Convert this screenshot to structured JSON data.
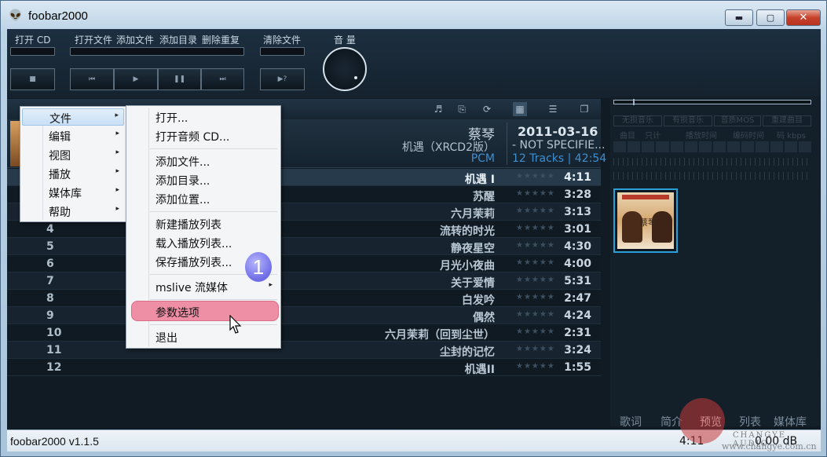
{
  "window": {
    "title": "foobar2000",
    "app_icon": "foobar-alien-icon",
    "min_label": "▬",
    "max_label": "▢",
    "close_label": "✕"
  },
  "toolbar": {
    "open_cd": "打开 CD",
    "open_file": "打开文件",
    "add_file": "添加文件",
    "add_dir": "添加目录",
    "remove_dup": "删除重复",
    "clear_files": "清除文件",
    "volume": "音 量",
    "stop_icon": "■",
    "prev_icon": "⏮",
    "play_icon": "▶",
    "pause_icon": "❚❚",
    "next_icon": "⏭",
    "random_icon": "▶?"
  },
  "info": {
    "artist": "蔡琴",
    "album": "机遇（XRCD2版）",
    "format": "PCM",
    "date": "2011-03-16",
    "genre": "- NOT SPECIFIE...",
    "tracks": "12 Tracks | 42:54"
  },
  "tracks": [
    {
      "num": "",
      "title": "机遇 I",
      "rating": "★★★★★",
      "length": "4:11"
    },
    {
      "num": "",
      "title": "苏醒",
      "rating": "★★★★★",
      "length": "3:28"
    },
    {
      "num": "",
      "title": "六月茉莉",
      "rating": "★★★★★",
      "length": "3:13"
    },
    {
      "num": "4",
      "title": "流转的时光",
      "rating": "★★★★★",
      "length": "3:01"
    },
    {
      "num": "5",
      "title": "静夜星空",
      "rating": "★★★★★",
      "length": "4:30"
    },
    {
      "num": "6",
      "title": "月光小夜曲",
      "rating": "★★★★★",
      "length": "4:00"
    },
    {
      "num": "7",
      "title": "关于爱情",
      "rating": "★★★★★",
      "length": "5:31"
    },
    {
      "num": "8",
      "title": "白发吟",
      "rating": "★★★★★",
      "length": "2:47"
    },
    {
      "num": "9",
      "title": "偶然",
      "rating": "★★★★★",
      "length": "4:24"
    },
    {
      "num": "10",
      "title": "六月茉莉（回到尘世）",
      "rating": "★★★★★",
      "length": "2:31"
    },
    {
      "num": "11",
      "title": "尘封的记忆",
      "rating": "★★★★★",
      "length": "3:24"
    },
    {
      "num": "12",
      "title": "机遇II",
      "rating": "★★★★★",
      "length": "1:55"
    }
  ],
  "right_panel": {
    "tabs": [
      "无损音乐",
      "有损音乐",
      "音质MOS",
      "重建曲目"
    ],
    "cols": [
      "曲目",
      "只计",
      "播放时间",
      "编码时间",
      "码 kbps"
    ],
    "album_art_title": "蔡琴"
  },
  "bottom_links": [
    "歌词",
    "简介",
    "预览",
    "列表",
    "媒体库"
  ],
  "status": {
    "text": "foobar2000 v1.1.5",
    "time": "4:11",
    "volume": "0.00 dB"
  },
  "menu_main": [
    {
      "label": "文件",
      "arrow": "▸"
    },
    {
      "label": "编辑",
      "arrow": "▸"
    },
    {
      "label": "视图",
      "arrow": "▸"
    },
    {
      "label": "播放",
      "arrow": "▸"
    },
    {
      "label": "媒体库",
      "arrow": "▸"
    },
    {
      "label": "帮助",
      "arrow": "▸"
    }
  ],
  "menu_file": {
    "open": "打开...",
    "open_cd": "打开音频 CD...",
    "add_file": "添加文件...",
    "add_dir": "添加目录...",
    "add_location": "添加位置...",
    "new_playlist": "新建播放列表",
    "load_playlist": "载入播放列表...",
    "save_playlist": "保存播放列表...",
    "mslive": "mslive 流媒体",
    "mslive_arrow": "▸",
    "preferences": "参数选项",
    "exit": "退出"
  },
  "annotation": {
    "badge": "1"
  },
  "watermark": {
    "line1": "CHANGYE AUDIO",
    "line2": "www.changye.com.cn"
  }
}
